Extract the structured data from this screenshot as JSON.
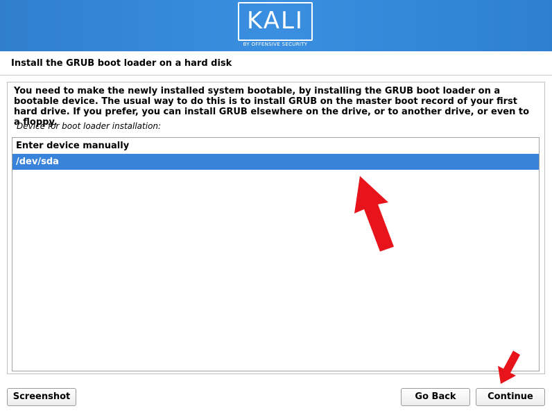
{
  "header": {
    "logo_text": "KALI",
    "logo_subtitle": "BY OFFENSIVE SECURITY"
  },
  "page": {
    "title": "Install the GRUB boot loader on a hard disk",
    "description": "You need to make the newly installed system bootable, by installing the GRUB boot loader on a bootable device. The usual way to do this is to install GRUB on the master boot record of your first hard drive. If you prefer, you can install GRUB elsewhere on the drive, or to another drive, or even to a floppy.",
    "prompt": "Device for boot loader installation:"
  },
  "device_list": {
    "items": [
      {
        "label": "Enter device manually",
        "selected": false
      },
      {
        "label": "/dev/sda",
        "selected": true
      }
    ],
    "selected_color": "#3a83da"
  },
  "buttons": {
    "screenshot": "Screenshot",
    "go_back": "Go Back",
    "continue": "Continue"
  },
  "annotations": {
    "arrow_color": "#e8141c",
    "arrow_icon": "red-arrow-icon"
  }
}
